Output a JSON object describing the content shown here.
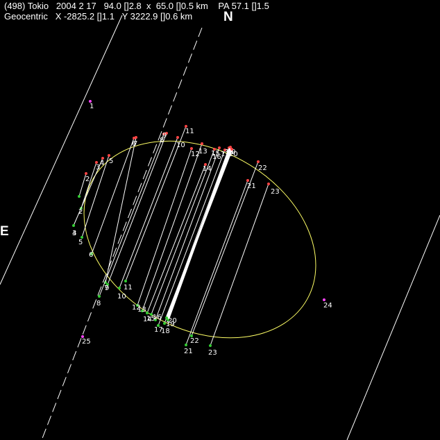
{
  "header": {
    "line1": "(498) Tokio   2004 2 17   94.0 []2.8  x  65.0 []0.5 km    PA 57.1 []1.5",
    "line2": "Geocentric   X -2825.2 []1.1   Y 3222.9 []0.6 km"
  },
  "north_label": "N",
  "east_label": "E",
  "colors": {
    "background": "#000000",
    "chord": "#ffffff",
    "ellipse": "#ffff66",
    "disappear": "#ff4444",
    "reappear": "#33cc33",
    "miss": "#ff44ff"
  },
  "chords": [
    {
      "id": "1",
      "status": "miss"
    },
    {
      "id": "2",
      "status": "positive"
    },
    {
      "id": "3",
      "status": "positive"
    },
    {
      "id": "4",
      "status": "positive"
    },
    {
      "id": "5",
      "status": "positive"
    },
    {
      "id": "6",
      "status": "positive"
    },
    {
      "id": "7",
      "status": "positive"
    },
    {
      "id": "8",
      "status": "positive"
    },
    {
      "id": "9",
      "status": "positive"
    },
    {
      "id": "10",
      "status": "positive"
    },
    {
      "id": "11",
      "status": "positive"
    },
    {
      "id": "12",
      "status": "positive"
    },
    {
      "id": "13",
      "status": "positive"
    },
    {
      "id": "14",
      "status": "positive"
    },
    {
      "id": "15",
      "status": "positive"
    },
    {
      "id": "16",
      "status": "positive"
    },
    {
      "id": "17",
      "status": "positive"
    },
    {
      "id": "18",
      "status": "positive"
    },
    {
      "id": "19",
      "status": "positive"
    },
    {
      "id": "20",
      "status": "positive"
    },
    {
      "id": "21",
      "status": "positive"
    },
    {
      "id": "22",
      "status": "positive"
    },
    {
      "id": "23",
      "status": "positive"
    },
    {
      "id": "24",
      "status": "miss"
    },
    {
      "id": "25",
      "status": "miss"
    }
  ]
}
